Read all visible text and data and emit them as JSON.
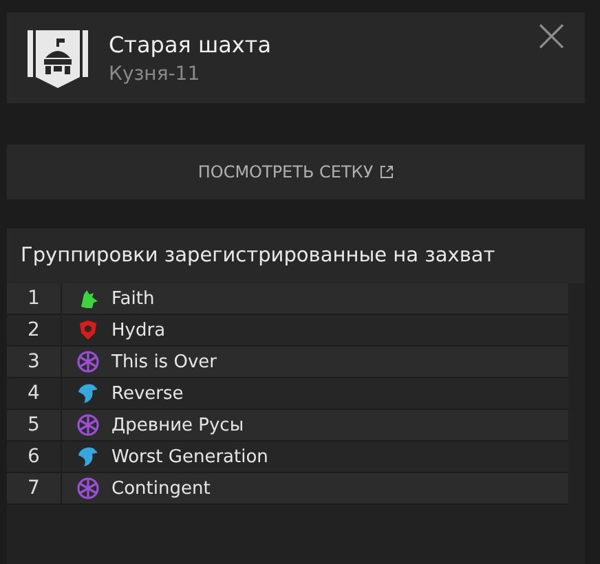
{
  "header": {
    "title": "Старая шахта",
    "subtitle": "Кузня-11",
    "close": "×"
  },
  "grid_button": {
    "label": "ПОСМОТРЕТЬ СЕТКУ"
  },
  "registered": {
    "title": "Группировки зарегистрированные на захват",
    "rows": [
      {
        "number": "1",
        "name": "Faith",
        "emblem": {
          "kind": "wolf",
          "color": "#3fd43f"
        }
      },
      {
        "number": "2",
        "name": "Hydra",
        "emblem": {
          "kind": "shield",
          "color": "#d81c1c"
        }
      },
      {
        "number": "3",
        "name": "This is Over",
        "emblem": {
          "kind": "wheel",
          "color": "#9b4fd6"
        }
      },
      {
        "number": "4",
        "name": "Reverse",
        "emblem": {
          "kind": "eagle",
          "color": "#35a9dc"
        }
      },
      {
        "number": "5",
        "name": "Древние Русы",
        "emblem": {
          "kind": "wheel",
          "color": "#9b4fd6"
        }
      },
      {
        "number": "6",
        "name": "Worst Generation",
        "emblem": {
          "kind": "eagle",
          "color": "#35a9dc"
        }
      },
      {
        "number": "7",
        "name": "Contingent",
        "emblem": {
          "kind": "wheel",
          "color": "#9b4fd6"
        }
      }
    ]
  }
}
